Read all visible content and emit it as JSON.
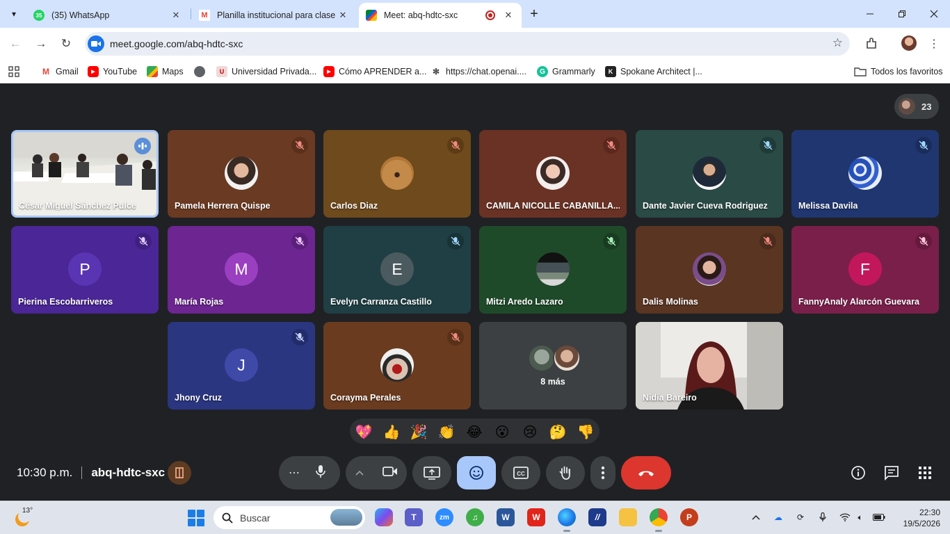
{
  "browser": {
    "tabs": [
      {
        "title": "(35) WhatsApp",
        "icon": "whatsapp-icon",
        "active": false
      },
      {
        "title": "Planilla institucional para clase de",
        "icon": "gmail-icon",
        "active": false
      },
      {
        "title": "Meet: abq-hdtc-sxc",
        "icon": "meet-icon",
        "active": true
      }
    ],
    "whatsapp_badge": "35",
    "url": "meet.google.com/abq-hdtc-sxc",
    "bookmarks": [
      {
        "label": "Gmail",
        "icon": "gmail-icon"
      },
      {
        "label": "YouTube",
        "icon": "youtube-icon"
      },
      {
        "label": "Maps",
        "icon": "maps-icon"
      },
      {
        "label": "",
        "icon": "globe-icon"
      },
      {
        "label": "Universidad Privada...",
        "icon": "university-icon"
      },
      {
        "label": "Cómo APRENDER a...",
        "icon": "youtube-icon"
      },
      {
        "label": "https://chat.openai....",
        "icon": "openai-icon"
      },
      {
        "label": "Grammarly",
        "icon": "grammarly-icon"
      },
      {
        "label": "Spokane Architect |...",
        "icon": "spokane-icon"
      }
    ],
    "all_bookmarks": "Todos los favoritos"
  },
  "meet": {
    "participant_count": "23",
    "participants": [
      {
        "name": "César Miguel Sánchez Pulce",
        "type": "video",
        "speaking": true
      },
      {
        "name": "Pamela Herrera Quispe",
        "type": "photo",
        "bg": "#6b3a22",
        "mute_bg": "#5a2f1b"
      },
      {
        "name": "Carlos Diaz",
        "type": "photo",
        "bg": "#6e4a1c",
        "mute_bg": "#5c3b15"
      },
      {
        "name": "CAMILA NICOLLE CABANILLA...",
        "type": "photo",
        "bg": "#6a3224",
        "mute_bg": "#5a281d"
      },
      {
        "name": "Dante Javier Cueva Rodriguez",
        "type": "photo",
        "bg": "#2a4a46",
        "mute_bg": "#1f3b38"
      },
      {
        "name": "Melissa Davila",
        "type": "photo",
        "bg": "#1f3670",
        "mute_bg": "#1a2c5b"
      },
      {
        "name": "Pierina Escobarriveros",
        "type": "initial",
        "initial": "P",
        "bg": "#4a2696",
        "circle": "#5a35b3",
        "mute_bg": "#3f207f"
      },
      {
        "name": "María Rojas",
        "type": "initial",
        "initial": "M",
        "bg": "#6c2591",
        "circle": "#9a3fbf",
        "mute_bg": "#5b1f7b"
      },
      {
        "name": "Evelyn Carranza Castillo",
        "type": "initial",
        "initial": "E",
        "bg": "#1f3f44",
        "circle": "#4b5a5f",
        "mute_bg": "#183236"
      },
      {
        "name": "Mitzi Aredo Lazaro",
        "type": "photo",
        "bg": "#1f4a2a",
        "mute_bg": "#183b21"
      },
      {
        "name": "Dalis Molinas",
        "type": "photo",
        "bg": "#5a3522",
        "mute_bg": "#4b2b1b"
      },
      {
        "name": "FannyAnaly Alarcón Guevara",
        "type": "initial",
        "initial": "F",
        "bg": "#7a1f4a",
        "circle": "#c2185b",
        "mute_bg": "#66193d"
      },
      {
        "name": "Jhony Cruz",
        "type": "initial",
        "initial": "J",
        "bg": "#2a3680",
        "circle": "#3f4aa8",
        "mute_bg": "#222c6b"
      },
      {
        "name": "Corayma Perales",
        "type": "photo",
        "bg": "#6a3b1e",
        "mute_bg": "#583118"
      },
      {
        "name": "",
        "type": "more",
        "more_label": "8 más",
        "bg": "#3c4043"
      },
      {
        "name": "Nidia Bareiro",
        "type": "video"
      }
    ],
    "reactions": [
      "💖",
      "👍",
      "🎉",
      "👏",
      "😂",
      "😮",
      "😢",
      "🤔",
      "👎"
    ],
    "time": "10:30 p.m.",
    "meeting_code": "abq-hdtc-sxc",
    "controls": [
      "more-options",
      "microphone",
      "present-chevron",
      "camera",
      "present-screen",
      "emoji-reactions",
      "captions",
      "raise-hand",
      "more-vert",
      "leave-call"
    ],
    "right_controls": [
      "info",
      "chat",
      "activities"
    ]
  },
  "taskbar": {
    "temperature": "13°",
    "search_placeholder": "Buscar",
    "time": "22:30",
    "date": "19/5/2026",
    "apps": [
      "copilot-icon",
      "teams-icon",
      "zoom-icon",
      "zoom-label",
      "word-icon",
      "wps-icon",
      "edge-icon",
      "vscode-like-icon",
      "explorer-icon",
      "chrome-icon",
      "powerpoint-icon"
    ],
    "zoom_label": "zm"
  }
}
